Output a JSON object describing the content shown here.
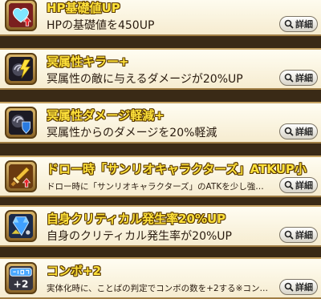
{
  "detail_label": "詳細",
  "skills": [
    {
      "title": "HP基礎値UP",
      "desc": "HPの基礎値を450UP",
      "icon": "heart-arrow-icon"
    },
    {
      "title": "冥属性キラー+",
      "desc": "冥属性の敵に与えるダメージが20%UP",
      "icon": "dark-killer-icon"
    },
    {
      "title": "冥属性ダメージ軽減+",
      "desc": "冥属性からのダメージを20%軽減",
      "icon": "dark-shield-icon"
    },
    {
      "title": "ドロー時「サンリオキャラクターズ」ATKUP小",
      "desc": "ドロー時に「サンリオキャラクターズ」のATKを少し強…",
      "icon": "sword-arrow-icon"
    },
    {
      "title": "自身クリティカル発生率20%UP",
      "desc": "自身のクリティカル発生率が20%UP",
      "icon": "critical-icon"
    },
    {
      "title": "コンボ+2",
      "desc": "実体化時に、ことばの判定でコンボの数を+2する※コン…",
      "icon": "combo-icon",
      "badge": "+2"
    }
  ]
}
